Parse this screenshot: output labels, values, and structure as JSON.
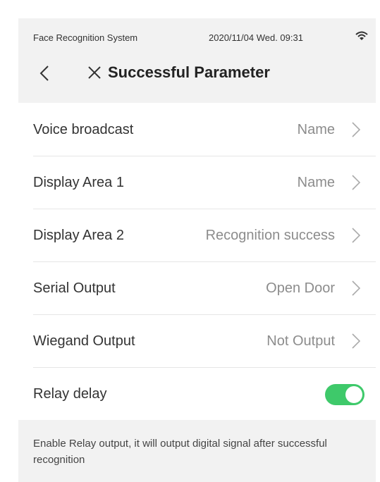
{
  "status_bar": {
    "app_name": "Face Recognition System",
    "datetime": "2020/11/04  Wed.  09:31",
    "wifi_icon": "wifi-icon"
  },
  "header": {
    "back_icon": "chevron-left-icon",
    "close_icon": "close-icon",
    "title": "Successful Parameter"
  },
  "settings": [
    {
      "label": "Voice broadcast",
      "value": "Name"
    },
    {
      "label": "Display Area 1",
      "value": "Name"
    },
    {
      "label": "Display Area 2",
      "value": "Recognition success"
    },
    {
      "label": "Serial Output",
      "value": "Open Door"
    },
    {
      "label": "Wiegand Output",
      "value": "Not Output"
    }
  ],
  "relay": {
    "label": "Relay delay",
    "enabled": true,
    "toggle_color": "#3ec96a"
  },
  "note": "Enable Relay output, it will output digital signal after successful recognition"
}
